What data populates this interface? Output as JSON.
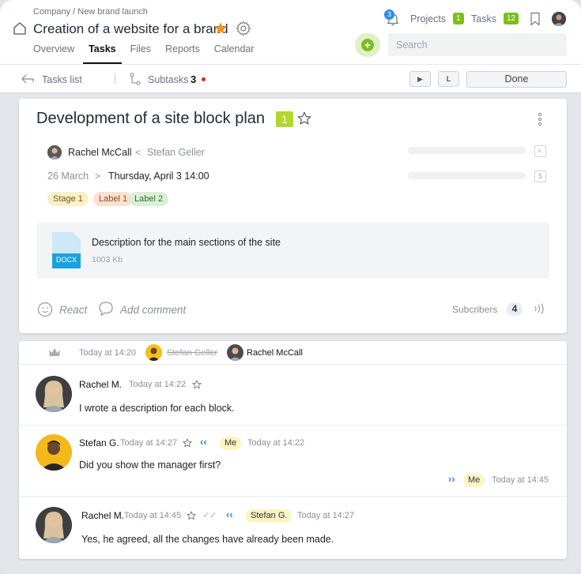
{
  "header": {
    "breadcrumb": "Company / New brand launch",
    "title": "Creation of a website for a brand",
    "tabs": [
      "Overview",
      "Tasks",
      "Files",
      "Reports",
      "Calendar"
    ],
    "active_tab": "Tasks",
    "notifications_count": "3",
    "projects_label": "Projects",
    "projects_count": "1",
    "tasks_label": "Tasks",
    "tasks_count": "12",
    "search_placeholder": "Search",
    "add_label": "+"
  },
  "toolbar": {
    "tasks_list": "Tasks list",
    "subtasks_label": "Subtasks",
    "subtasks_count": "3",
    "play_label": "▶",
    "l_label": "L",
    "done_label": "Done"
  },
  "task": {
    "title": "Development of a site block plan",
    "badge": "1",
    "responsible": "Rachel McCall",
    "creator_sep": "<",
    "creator": "Stefan Geller",
    "start_date": "26 March",
    "date_sep": ">",
    "deadline": "Thursday, April 3 14:00",
    "time_icon": "clock-icon",
    "cost_icon": "dollar-icon",
    "tags": [
      {
        "label": "Stage 1",
        "bg": "#fbefc6",
        "color": "#6b5a1e"
      },
      {
        "label": "Label 1",
        "bg": "#fde1cf",
        "color": "#8a4b22"
      },
      {
        "label": "Label 2",
        "bg": "#d9efd6",
        "color": "#3e6a38"
      }
    ],
    "file": {
      "name": "Description for the main sections of the site",
      "size": "1003 Kb",
      "type": "DOCX"
    },
    "react_label": "React",
    "add_comment": "Add comment",
    "subscribers_label": "Subcribers",
    "subscribers_count": "4"
  },
  "log": {
    "time": "Today at 14:20",
    "old_assignee": "Stefan Geller",
    "new_assignee": "Rachel McCall"
  },
  "messages": [
    {
      "author": "Rachel M.",
      "time": "Today at 14:22",
      "text": "I wrote a description for each block."
    },
    {
      "author": "Stefan G.",
      "time": "Today at 14:27",
      "reply_to": "Me",
      "reply_time": "Today at 14:22",
      "text": "Did you show the manager first?",
      "answered_by": "Me",
      "answered_time": "Today at 14:45"
    },
    {
      "author": "Rachel M.",
      "time": "Today at 14:45",
      "reply_to": "Stefan G.",
      "reply_time": "Today at 14:27",
      "text": "Yes, he agreed, all the changes have already been made."
    }
  ],
  "colors": {
    "accent_green": "#7dbd1e",
    "star_orange": "#f0961b",
    "link_blue": "#2d8cf0",
    "chip_yellow": "#fdf4c4"
  }
}
